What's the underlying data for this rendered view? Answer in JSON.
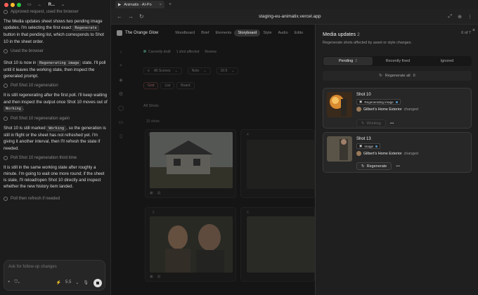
{
  "chat": {
    "tab_title": "R...",
    "steps": {
      "approved": "Approved request, used the browser",
      "used_browser": "Used the browser",
      "poll1": "Poll Shot 10 regeneration",
      "poll2": "Poll Shot 10 regeneration again",
      "poll3": "Poll Shot 10 regeneration third time",
      "poll_refresh": "Poll then refresh if needed"
    },
    "msg1_a": "The Media updates sheet shows two pending image updates. I'm selecting the first exact",
    "msg1_code": "Regenerate",
    "msg1_b": "button in that pending list, which corresponds to Shot 10 in the sheet order.",
    "msg2_a": "Shot 10 is now in",
    "msg2_code": "Regenerating image",
    "msg2_b": "state. I'll poll until it leaves the working state, then inspect the generated prompt.",
    "msg3_a": "It is still regenerating after the first poll. I'll keep waiting and then inspect the output once Shot 10 moves out of",
    "msg3_code": "Working",
    "msg3_b": ".",
    "msg4_a": "Shot 10 is still marked",
    "msg4_code": "Working",
    "msg4_b": ", so the generation is still in flight or the sheet has not refreshed yet. I'm giving it another interval, then I'll refresh the state if needed.",
    "msg5": "It is still in the same working state after roughly a minute. I'm going to wait one more round; if the sheet is stale, I'll reload/open Shot 10 directly and inspect whether the new history item landed.",
    "composer_placeholder": "Ask for follow-up changes",
    "model": "5.5"
  },
  "browser": {
    "tab_label": "Animatix - AI-Po",
    "url": "staging-eu-animatix.vercel.app"
  },
  "app": {
    "brand": "The Orange Glow",
    "nav": [
      "Moodboard",
      "Brief",
      "Elements",
      "Storyboard",
      "Style",
      "Audio",
      "Edito"
    ],
    "active_nav": "Storyboard",
    "crumbs": [
      "Currently draft",
      "1 shot affected",
      "Review"
    ],
    "filters": [
      "All Scenes",
      "Note",
      "16:9"
    ],
    "views": [
      "Grid",
      "List",
      "Board"
    ],
    "section": "All Shots",
    "count": "15 shots",
    "shot_numbers": [
      "3",
      "4",
      "5",
      "6"
    ]
  },
  "panel": {
    "title": "Media updates",
    "count": "2",
    "subtitle": "Regenerate shots affected by asset or style changes.",
    "pager": "6 of 7",
    "tabs": [
      {
        "label": "Pending",
        "badge": "2"
      },
      {
        "label": "Recently fixed",
        "badge": ""
      },
      {
        "label": "Ignored",
        "badge": ""
      }
    ],
    "regen_all": "Regenerate all",
    "regen_all_badge": "0",
    "cards": [
      {
        "shot": "Shot 10",
        "badge": "Regenerating image",
        "asset": "Gilbert's Home Exterior",
        "verb": "changed",
        "action": "Working"
      },
      {
        "shot": "Shot 13",
        "badge": "Image",
        "asset": "Gilbert's Home Exterior",
        "verb": "changed",
        "action": "Regenerate"
      }
    ]
  },
  "colors": {
    "accent": "#59c",
    "window_red": "#ff5f57",
    "window_yellow": "#febc2e",
    "window_green": "#28c840"
  }
}
